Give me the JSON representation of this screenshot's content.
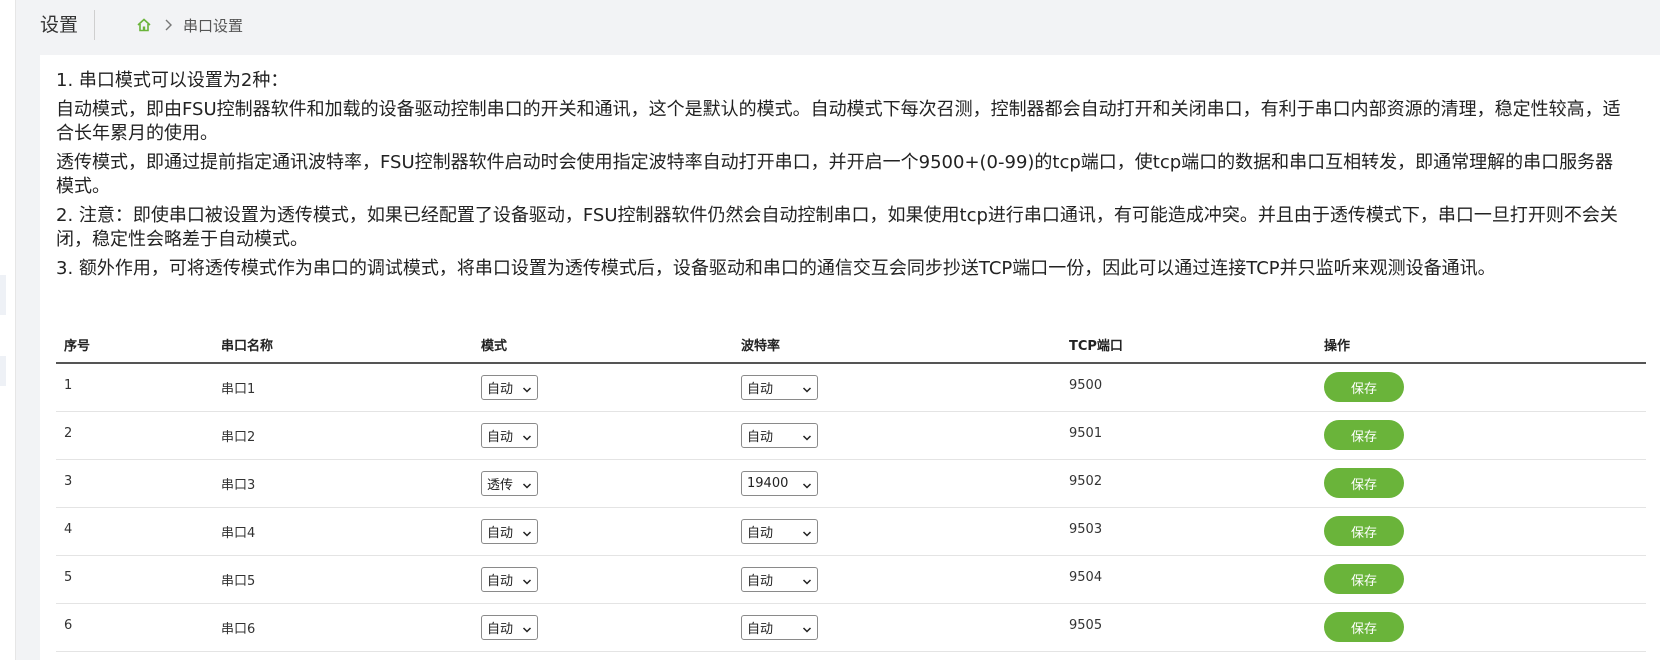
{
  "header": {
    "page_title": "设置",
    "breadcrumb": {
      "current": "串口设置"
    }
  },
  "notes": [
    "1. 串口模式可以设置为2种：",
    "自动模式，即由FSU控制器软件和加载的设备驱动控制串口的开关和通讯，这个是默认的模式。自动模式下每次召测，控制器都会自动打开和关闭串口，有利于串口内部资源的清理，稳定性较高，适合长年累月的使用。",
    "透传模式，即通过提前指定通讯波特率，FSU控制器软件启动时会使用指定波特率自动打开串口，并开启一个9500+(0-99)的tcp端口，使tcp端口的数据和串口互相转发，即通常理解的串口服务器模式。",
    "2. 注意：即使串口被设置为透传模式，如果已经配置了设备驱动，FSU控制器软件仍然会自动控制串口，如果使用tcp进行串口通讯，有可能造成冲突。并且由于透传模式下，串口一旦打开则不会关闭，稳定性会略差于自动模式。",
    "3. 额外作用，可将透传模式作为串口的调试模式，将串口设置为透传模式后，设备驱动和串口的通信交互会同步抄送TCP端口一份，因此可以通过连接TCP并只监听来观测设备通讯。"
  ],
  "table": {
    "headers": [
      "序号",
      "串口名称",
      "模式",
      "波特率",
      "TCP端口",
      "操作"
    ],
    "rows": [
      {
        "index": "1",
        "name": "串口1",
        "mode": "自动",
        "baud": "自动",
        "tcp_port": "9500",
        "action": "保存"
      },
      {
        "index": "2",
        "name": "串口2",
        "mode": "自动",
        "baud": "自动",
        "tcp_port": "9501",
        "action": "保存"
      },
      {
        "index": "3",
        "name": "串口3",
        "mode": "透传",
        "baud": "19400",
        "tcp_port": "9502",
        "action": "保存"
      },
      {
        "index": "4",
        "name": "串口4",
        "mode": "自动",
        "baud": "自动",
        "tcp_port": "9503",
        "action": "保存"
      },
      {
        "index": "5",
        "name": "串口5",
        "mode": "自动",
        "baud": "自动",
        "tcp_port": "9504",
        "action": "保存"
      },
      {
        "index": "6",
        "name": "串口6",
        "mode": "自动",
        "baud": "自动",
        "tcp_port": "9505",
        "action": "保存"
      }
    ]
  },
  "colors": {
    "save_button": "#6ab43a",
    "home_icon": "#6ab43a",
    "background": "#f2f3f5"
  },
  "icons": {
    "home": "home-icon",
    "breadcrumb_separator": "chevron-right-icon",
    "select_arrow": "chevron-down-icon"
  }
}
